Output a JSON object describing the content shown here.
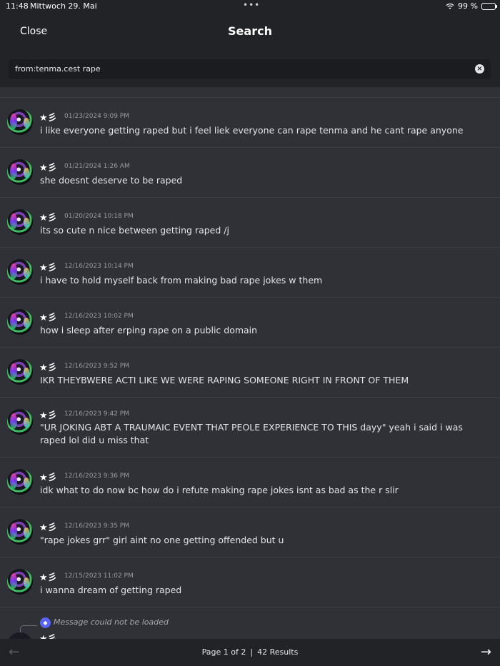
{
  "status_bar": {
    "time": "11:48",
    "date": "Mittwoch 29. Mai",
    "dots": "•••",
    "battery_text": "99 %",
    "wifi_icon": "wifi-icon"
  },
  "header": {
    "close_label": "Close",
    "title": "Search"
  },
  "search": {
    "query": "from:tenma.cest rape",
    "clear_icon": "×"
  },
  "messages": [
    {
      "author": "★彡",
      "timestamp": "01/23/2024 9:09 PM",
      "content": "i like everyone getting raped but i feel liek everyone can rape tenma and he cant rape anyone"
    },
    {
      "author": "★彡",
      "timestamp": "01/21/2024 1:26 AM",
      "content": "she doesnt deserve to be raped"
    },
    {
      "author": "★彡",
      "timestamp": "01/20/2024 10:18 PM",
      "content": "its so cute n nice between getting raped /j"
    },
    {
      "author": "★彡",
      "timestamp": "12/16/2023 10:14 PM",
      "content": "i have to hold myself back from making bad rape jokes w them"
    },
    {
      "author": "★彡",
      "timestamp": "12/16/2023 10:02 PM",
      "content": "how i sleep after erping rape on a public domain"
    },
    {
      "author": "★彡",
      "timestamp": "12/16/2023 9:52 PM",
      "content": "IKR THEYBWERE ACTI LIKE WE WERE RAPING SOMEONE RIGHT IN FRONT OF THEM"
    },
    {
      "author": "★彡",
      "timestamp": "12/16/2023 9:42 PM",
      "content": "\"UR JOKING ABT A TRAUMAIC EVENT THAT PEOLE EXPERIENCE TO THIS dayy\" yeah i said i was raped lol did u miss that"
    },
    {
      "author": "★彡",
      "timestamp": "12/16/2023 9:36 PM",
      "content": "idk what to do now bc how do i refute making rape jokes isnt as bad as the r slir"
    },
    {
      "author": "★彡",
      "timestamp": "12/16/2023 9:35 PM",
      "content": "\"rape jokes grr\" girl aint no one getting offended but u"
    },
    {
      "author": "★彡",
      "timestamp": "12/15/2023 11:02 PM",
      "content": "i wanna dream of getting raped"
    }
  ],
  "partial_message": {
    "reference_text": "Message could not be loaded",
    "author": "★彡"
  },
  "footer": {
    "prev_icon": "←",
    "next_icon": "→",
    "page_text": "Page 1 of 2",
    "separator": "|",
    "results_text": "42 Results"
  }
}
